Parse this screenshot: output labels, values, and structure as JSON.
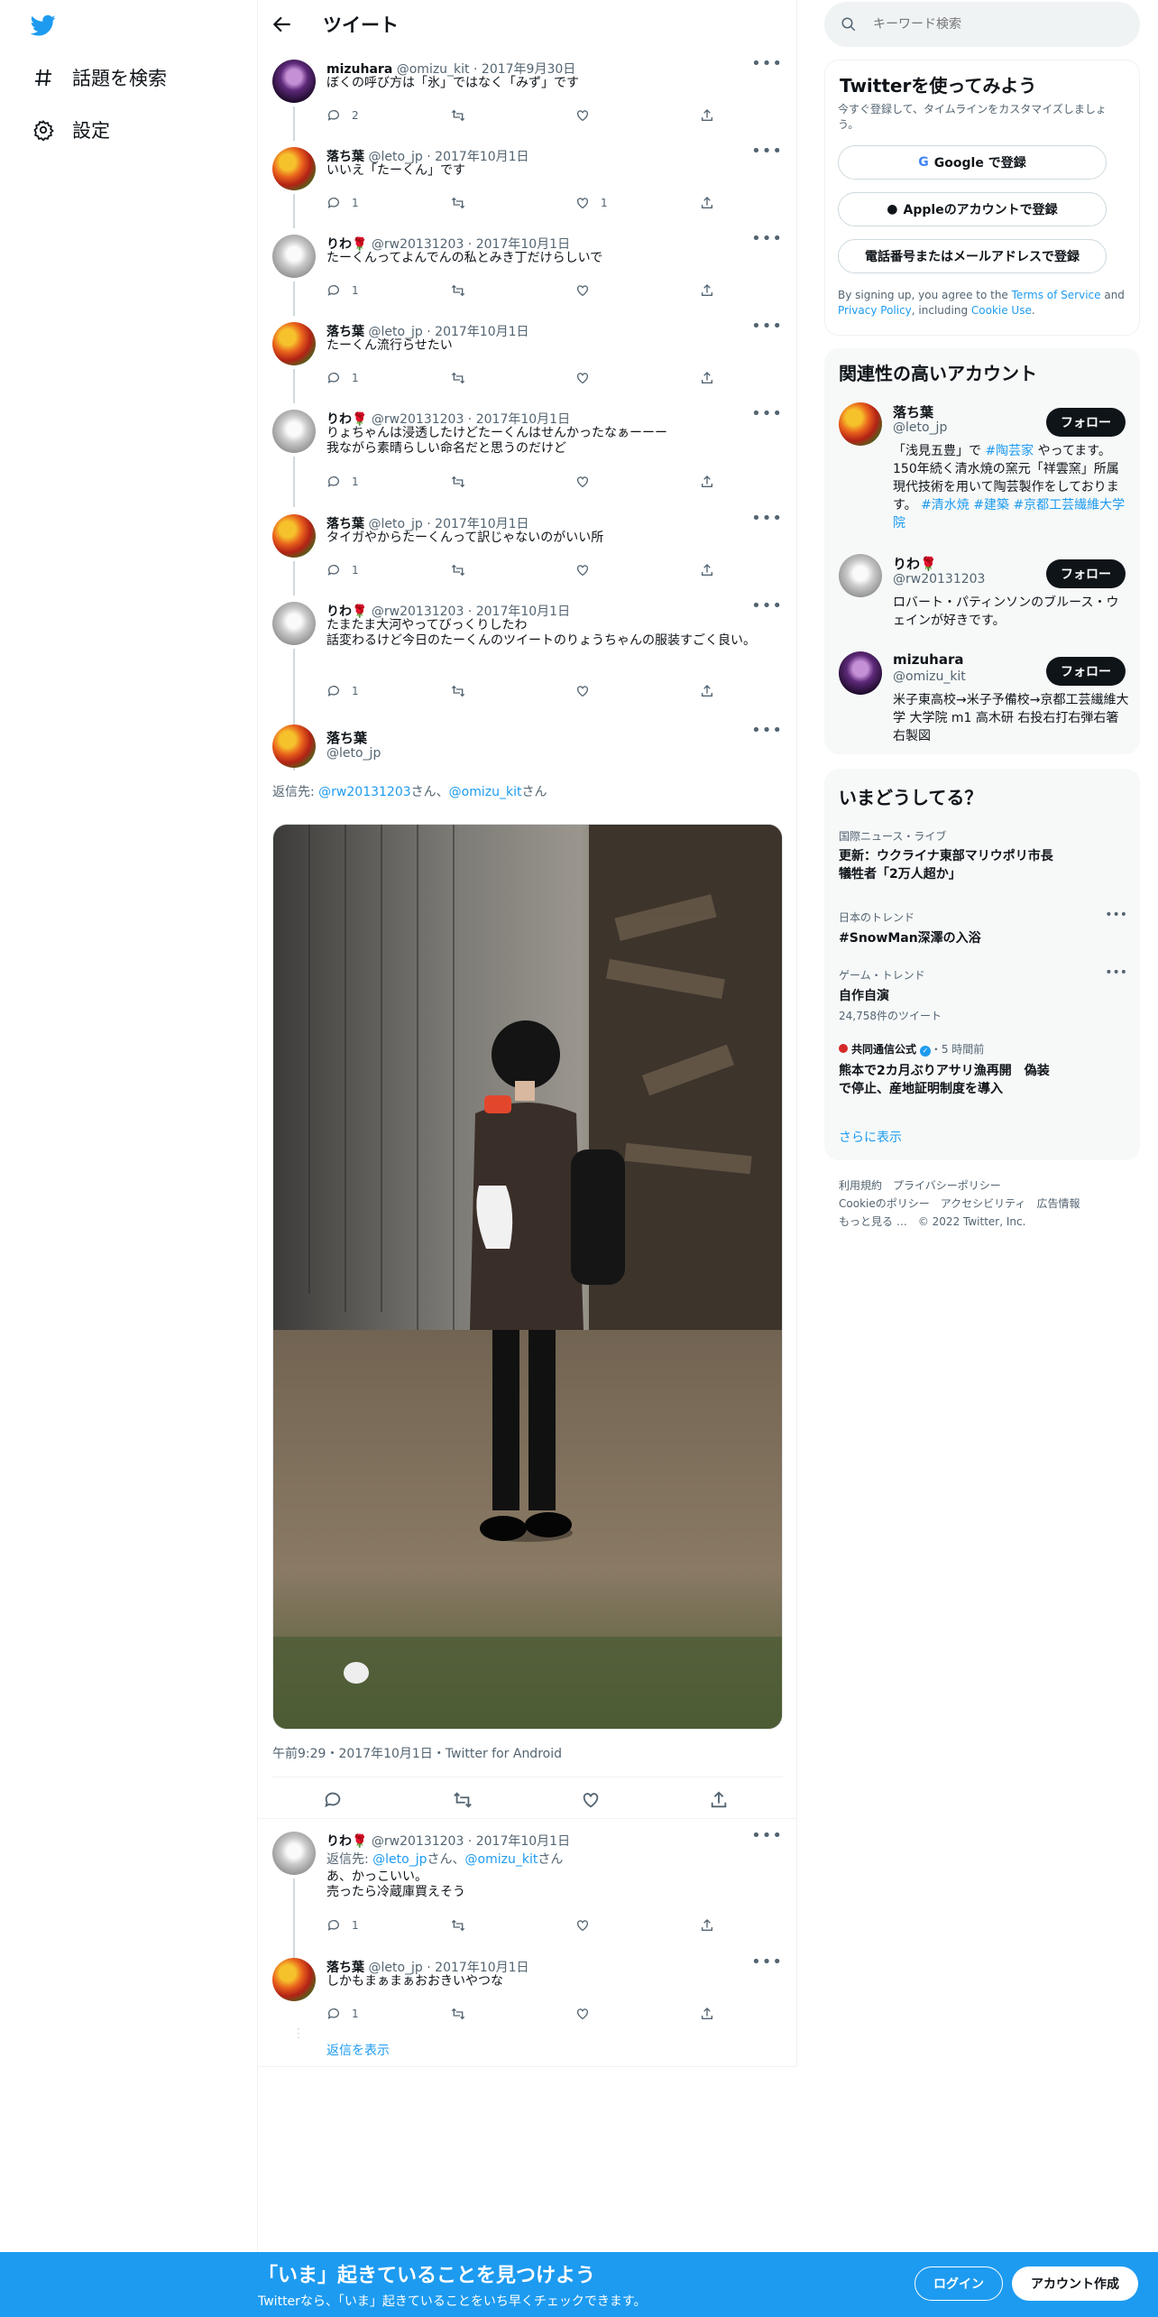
{
  "nav": {
    "items": [
      {
        "label": "話題を検索",
        "icon": "hashtag-icon"
      },
      {
        "label": "設定",
        "icon": "gear-icon"
      }
    ]
  },
  "header": {
    "title": "ツイート"
  },
  "replies_above": [
    {
      "name": "mizuhara",
      "handle": "@omizu_kit",
      "date": "2017年9月30日",
      "text": "ぼくの呼び方は「氷」ではなく「みず」です",
      "replies": "2",
      "retweets": "",
      "likes": ""
    },
    {
      "name": "落ち葉",
      "handle": "@leto_jp",
      "date": "2017年10月1日",
      "text": "いいえ「たーくん」です",
      "replies": "1",
      "retweets": "",
      "likes": "1"
    },
    {
      "name": "りわ🌹",
      "handle": "@rw20131203",
      "date": "2017年10月1日",
      "text": "たーくんってよんでんの私とみき丁だけらしいで",
      "replies": "1",
      "retweets": "",
      "likes": ""
    },
    {
      "name": "落ち葉",
      "handle": "@leto_jp",
      "date": "2017年10月1日",
      "text": "たーくん流行らせたい",
      "replies": "1",
      "retweets": "",
      "likes": ""
    },
    {
      "name": "りわ🌹",
      "handle": "@rw20131203",
      "date": "2017年10月1日",
      "text": "りょちゃんは浸透したけどたーくんはせんかったなぁーーー\n我ながら素晴らしい命名だと思うのだけど",
      "replies": "1",
      "retweets": "",
      "likes": ""
    },
    {
      "name": "落ち葉",
      "handle": "@leto_jp",
      "date": "2017年10月1日",
      "text": "タイガやからたーくんって訳じゃないのがいい所",
      "replies": "1",
      "retweets": "",
      "likes": ""
    },
    {
      "name": "りわ🌹",
      "handle": "@rw20131203",
      "date": "2017年10月1日",
      "text": "たまたま大河やってびっくりしたわ\n話変わるけど今日のたーくんのツイートのりょうちゃんの服装すごく良い。",
      "replies": "1",
      "retweets": "",
      "likes": ""
    }
  ],
  "main_tweet": {
    "name": "落ち葉",
    "handle": "@leto_jp",
    "reply_prefix": "返信先: ",
    "reply_to_1": "@rw20131203",
    "reply_sep_1": "さん、",
    "reply_to_2": "@omizu_kit",
    "reply_sep_2": "さん",
    "timestamp": "午前9:29・2017年10月1日・Twitter for Android"
  },
  "replies_below": [
    {
      "name": "りわ🌹",
      "handle": "@rw20131203",
      "date": "2017年10月1日",
      "reply_prefix": "返信先: ",
      "reply_to_1": "@leto_jp",
      "reply_sep_1": "さん、",
      "reply_to_2": "@omizu_kit",
      "reply_sep_2": "さん",
      "text": "あ、かっこいい。\n売ったら冷蔵庫買えそう",
      "replies": "1",
      "retweets": "",
      "likes": ""
    },
    {
      "name": "落ち葉",
      "handle": "@leto_jp",
      "date": "2017年10月1日",
      "text": "しかもまぁまぁおおきいやつな",
      "replies": "1",
      "retweets": "",
      "likes": ""
    }
  ],
  "show_replies": "返信を表示",
  "sidebar": {
    "search_placeholder": "キーワード検索",
    "signup": {
      "title": "Twitterを使ってみよう",
      "subtitle": "今すぐ登録して、タイムラインをカスタマイズしましょう。",
      "google": "Google で登録",
      "apple": "Appleのアカウントで登録",
      "phone": "電話番号またはメールアドレスで登録",
      "terms_1": "By signing up, you agree to the ",
      "terms_link": "Terms of Service",
      "terms_2": " and ",
      "privacy_link": "Privacy Policy",
      "terms_3": ", including ",
      "cookie_link": "Cookie Use",
      "terms_4": "."
    },
    "related": {
      "title": "関連性の高いアカウント",
      "follow_label": "フォロー",
      "accounts": [
        {
          "name": "落ち葉",
          "handle": "@leto_jp",
          "bio_1": "「浅見五豊」で ",
          "bio_tag1": "#陶芸家",
          "bio_2": " やってます。150年続く清水焼の窯元「祥雲窯」所属 現代技術を用いて陶芸製作をしております。 ",
          "bio_tag2": "#清水焼",
          "bio_sp1": " ",
          "bio_tag3": "#建築",
          "bio_sp2": " ",
          "bio_tag4": "#京都工芸繊維大学院"
        },
        {
          "name": "りわ🌹",
          "handle": "@rw20131203",
          "bio": "ロバート・パティンソンのブルース・ウェインが好きです。"
        },
        {
          "name": "mizuhara",
          "handle": "@omizu_kit",
          "bio": "米子東高校→米子予備校→京都工芸繊維大学 大学院 m1 高木研 右投右打右弾右箸右製図"
        }
      ]
    },
    "trends": {
      "title": "いまどうしてる？",
      "items": [
        {
          "category": "国際ニュース・ライブ",
          "title": "更新：ウクライナ東部マリウポリ市長 犠牲者「2万人超か」",
          "count": ""
        },
        {
          "category": "日本のトレンド",
          "title": "#SnowMan深澤の入浴",
          "count": ""
        },
        {
          "category": "ゲーム・トレンド",
          "title": "自作自演",
          "count": "24,758件のツイート"
        },
        {
          "category": "共同通信公式",
          "time": "・5 時間前",
          "title": "熊本で2カ月ぶりアサリ漁再開　偽装で停止、産地証明制度を導入",
          "count": ""
        }
      ],
      "show_more": "さらに表示"
    },
    "footer": {
      "links": [
        "利用規約",
        "プライバシーポリシー",
        "Cookieのポリシー",
        "アクセシビリティ",
        "広告情報",
        "もっと見る …"
      ],
      "copyright": "© 2022 Twitter, Inc."
    }
  },
  "banner": {
    "title": "「いま」起きていることを見つけよう",
    "subtitle": "Twitterなら、「いま」起きていることをいち早くチェックできます。",
    "login": "ログイン",
    "signup": "アカウント作成"
  },
  "colors": {
    "accent": "#1d9bf0",
    "text": "#0f1419",
    "muted": "#536471"
  }
}
